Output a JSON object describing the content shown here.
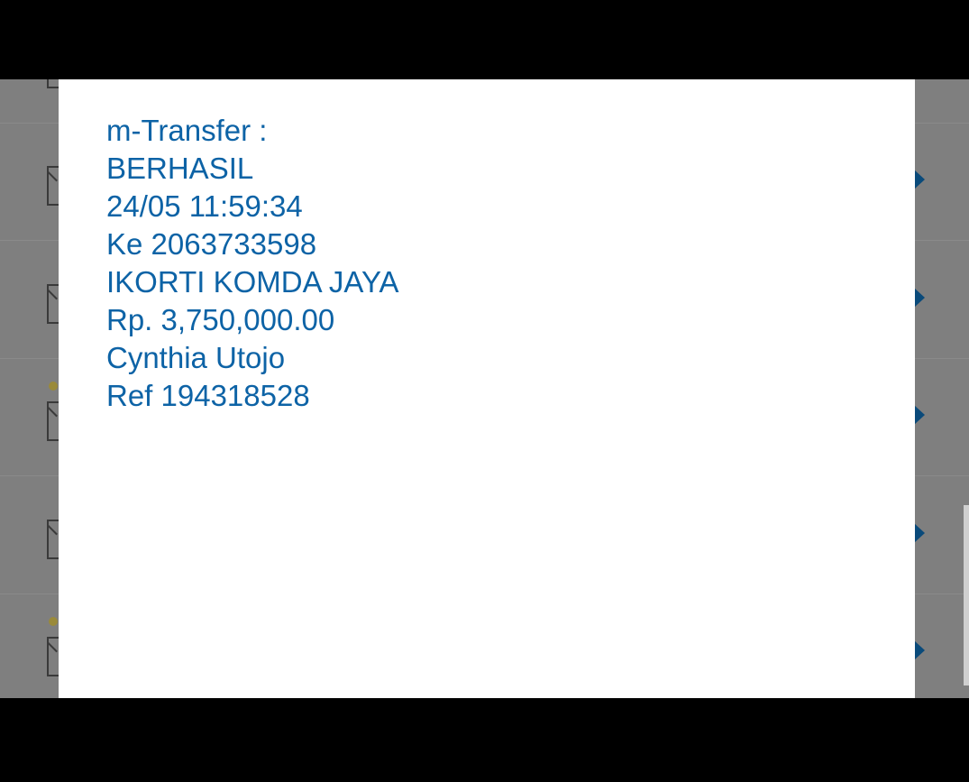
{
  "dialog": {
    "lines": {
      "service": "m-Transfer :",
      "status": "BERHASIL",
      "datetime": "24/05 11:59:34",
      "destination": "Ke 2063733598",
      "recipient_name": "IKORTI KOMDA JAYA",
      "amount": "Rp. 3,750,000.00",
      "sender_name": "Cynthia Utojo",
      "reference": "Ref 194318528"
    },
    "text_color": "#0d63a6",
    "background_color": "#ffffff"
  },
  "background_list": {
    "overlay_color": "#7f7f7f",
    "row_icons": [
      "envelope-icon",
      "envelope-icon",
      "envelope-icon",
      "envelope-icon",
      "envelope-icon"
    ],
    "row_chevron_icon": "chevron-right-icon"
  }
}
